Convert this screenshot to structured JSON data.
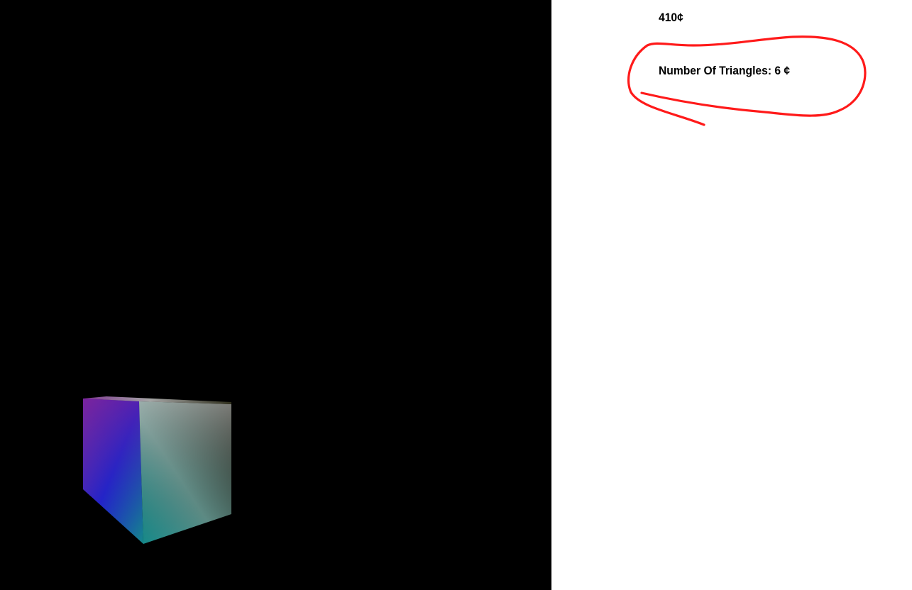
{
  "viewport": {
    "background_color": "#000000"
  },
  "info_panel": {
    "fps_text": "410¢",
    "triangles_text": "Number Of Triangles: 6 ¢",
    "annotation_color": "#ff1a1a"
  }
}
